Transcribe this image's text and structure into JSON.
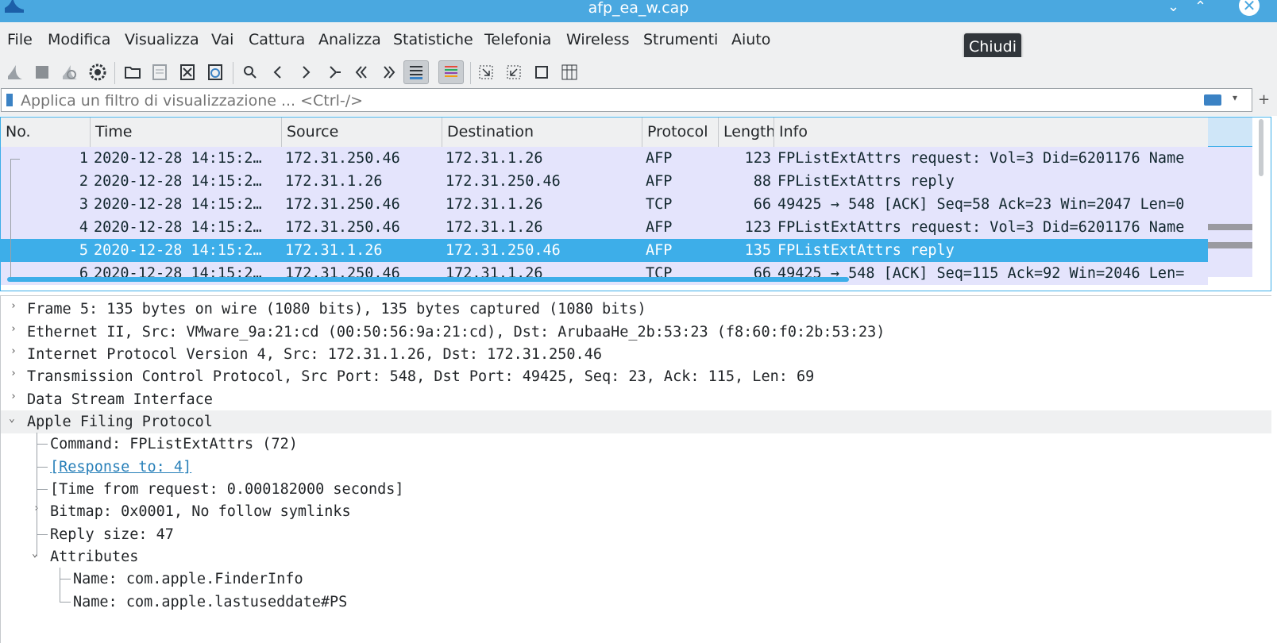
{
  "window": {
    "title": "afp_ea_w.cap",
    "tooltip": "Chiudi"
  },
  "menu": [
    "File",
    "Modifica",
    "Visualizza",
    "Vai",
    "Cattura",
    "Analizza",
    "Statistiche",
    "Telefonia",
    "Wireless",
    "Strumenti",
    "Aiuto"
  ],
  "filter": {
    "placeholder": "Applica un filtro di visualizzazione ... <Ctrl-/>"
  },
  "columns": [
    "No.",
    "Time",
    "Source",
    "Destination",
    "Protocol",
    "Length",
    "Info"
  ],
  "packets": [
    {
      "no": "1",
      "time": "2020-12-28 14:15:2…",
      "src": "172.31.250.46",
      "dst": "172.31.1.26",
      "proto": "AFP",
      "len": "123",
      "info": "FPListExtAttrs request: Vol=3 Did=6201176 Name"
    },
    {
      "no": "2",
      "time": "2020-12-28 14:15:2…",
      "src": "172.31.1.26",
      "dst": "172.31.250.46",
      "proto": "AFP",
      "len": "88",
      "info": "FPListExtAttrs reply"
    },
    {
      "no": "3",
      "time": "2020-12-28 14:15:2…",
      "src": "172.31.250.46",
      "dst": "172.31.1.26",
      "proto": "TCP",
      "len": "66",
      "info": "49425 → 548 [ACK] Seq=58 Ack=23 Win=2047 Len=0"
    },
    {
      "no": "4",
      "time": "2020-12-28 14:15:2…",
      "src": "172.31.250.46",
      "dst": "172.31.1.26",
      "proto": "AFP",
      "len": "123",
      "info": "FPListExtAttrs request: Vol=3 Did=6201176 Name"
    },
    {
      "no": "5",
      "time": "2020-12-28 14:15:2…",
      "src": "172.31.1.26",
      "dst": "172.31.250.46",
      "proto": "AFP",
      "len": "135",
      "info": "FPListExtAttrs reply"
    },
    {
      "no": "6",
      "time": "2020-12-28 14:15:2…",
      "src": "172.31.250.46",
      "dst": "172.31.1.26",
      "proto": "TCP",
      "len": "66",
      "info": "49425 → 548 [ACK] Seq=115 Ack=92 Win=2046 Len="
    }
  ],
  "selected_packet": "5",
  "details": [
    {
      "text": "Frame 5: 135 bytes on wire (1080 bits), 135 bytes captured (1080 bits)",
      "toggle": "collapsed"
    },
    {
      "text": "Ethernet II, Src: VMware_9a:21:cd (00:50:56:9a:21:cd), Dst: ArubaaHe_2b:53:23 (f8:60:f0:2b:53:23)",
      "toggle": "collapsed"
    },
    {
      "text": "Internet Protocol Version 4, Src: 172.31.1.26, Dst: 172.31.250.46",
      "toggle": "collapsed"
    },
    {
      "text": "Transmission Control Protocol, Src Port: 548, Dst Port: 49425, Seq: 23, Ack: 115, Len: 69",
      "toggle": "collapsed"
    },
    {
      "text": "Data Stream Interface",
      "toggle": "collapsed"
    },
    {
      "text": "Apple Filing Protocol",
      "toggle": "expanded"
    },
    {
      "text": "Command: FPListExtAttrs (72)"
    },
    {
      "text": "[Response to: 4]",
      "link": true
    },
    {
      "text": "[Time from request: 0.000182000 seconds]"
    },
    {
      "text": "Bitmap: 0x0001, No follow symlinks",
      "toggle": "collapsed"
    },
    {
      "text": "Reply size: 47"
    },
    {
      "text": "Attributes",
      "toggle": "expanded"
    },
    {
      "text": "Name: com.apple.FinderInfo"
    },
    {
      "text": "Name: com.apple.lastuseddate#PS"
    }
  ],
  "colors": {
    "titlebar": "#4aa8e0",
    "selection": "#3daee9",
    "row_bg": "#e4e4fc",
    "link": "#2980b9"
  },
  "icons": [
    "shark-fin-icon",
    "stop-square-icon",
    "restart-fin-icon",
    "gear-options-icon",
    "open-folder-icon",
    "save-file-icon",
    "close-file-icon",
    "reload-file-icon",
    "search-icon",
    "chevron-left-icon",
    "chevron-right-icon",
    "go-to-packet-icon",
    "first-packet-icon",
    "last-packet-icon",
    "autoscroll-icon",
    "colorize-icon",
    "zoom-in-icon",
    "zoom-out-icon",
    "normal-size-icon",
    "resize-columns-icon"
  ]
}
